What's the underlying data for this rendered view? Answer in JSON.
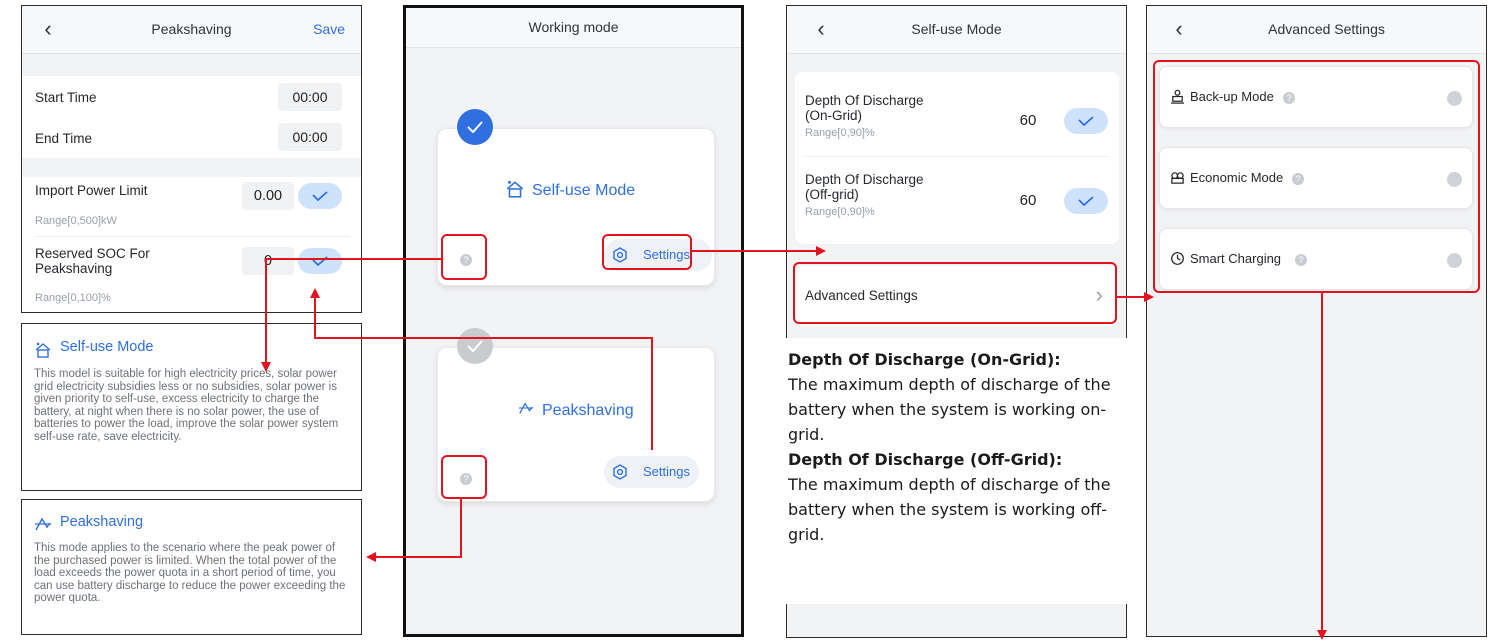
{
  "peakshaving_panel": {
    "nav": {
      "back_icon": "chevron-left-icon",
      "title": "Peakshaving",
      "save_label": "Save"
    },
    "start_time": {
      "label": "Start Time",
      "value": "00:00"
    },
    "end_time": {
      "label": "End Time",
      "value": "00:00"
    },
    "import_power_limit": {
      "label": "Import Power Limit",
      "value": "0.00",
      "range": "Range[0,500]kW"
    },
    "reserved_soc": {
      "label_line1": "Reserved SOC For",
      "label_line2": "Peakshaving",
      "value": "0",
      "range": "Range[0,100]%"
    }
  },
  "selfuse_desc": {
    "title": "Self-use Mode",
    "icon": "home-solar-icon",
    "text": "This model is suitable for high electricity prices, solar power grid electricity subsidies less or no subsidies, solar power is given priority to self-use, excess electricity to charge the battery, at night when there is no solar power, the use of batteries to power the load, improve the solar power system self-use rate, save electricity."
  },
  "peakshaving_desc": {
    "title": "Peakshaving",
    "icon": "peakshaving-icon",
    "text": "This mode applies to the scenario where the peak power of the purchased power is limited. When the total power of the load exceeds the power quota in a short period of time, you can use battery discharge to reduce the power exceeding the power quota."
  },
  "working_mode_panel": {
    "nav": {
      "title": "Working mode"
    },
    "selfuse_card": {
      "title": "Self-use Mode",
      "settings_label": "Settings",
      "selected": true
    },
    "peakshaving_card": {
      "title": "Peakshaving",
      "settings_label": "Settings",
      "selected": false
    }
  },
  "selfuse_panel": {
    "nav": {
      "back_icon": "chevron-left-icon",
      "title": "Self-use Mode"
    },
    "dod_on_grid": {
      "label_line1": "Depth Of Discharge",
      "label_line2": "(On-Grid)",
      "range": "Range[0,90]%",
      "value": "60"
    },
    "dod_off_grid": {
      "label_line1": "Depth Of Discharge",
      "label_line2": "(Off-grid)",
      "range": "Range[0,90]%",
      "value": "60"
    },
    "advanced_settings": {
      "label": "Advanced Settings",
      "chevron_icon": "chevron-right-icon"
    }
  },
  "explanation": {
    "on_grid_title": "Depth Of Discharge (On-Grid):",
    "on_grid_text": "The maximum depth of discharge of the battery when the system is working on-grid.",
    "off_grid_title": "Depth Of Discharge (Off-Grid):",
    "off_grid_text": "The maximum depth of discharge of the battery when the system is working off-grid."
  },
  "advanced_panel": {
    "nav": {
      "back_icon": "chevron-left-icon",
      "title": "Advanced Settings"
    },
    "items": [
      {
        "label": "Back-up Mode",
        "icon": "backup-icon"
      },
      {
        "label": "Economic Mode",
        "icon": "economic-icon"
      },
      {
        "label": "Smart Charging",
        "icon": "clock-icon"
      }
    ]
  },
  "colors": {
    "accent": "#2f6fe0",
    "annotation": "#e0141e",
    "check_pill": "#cfe2fb"
  }
}
